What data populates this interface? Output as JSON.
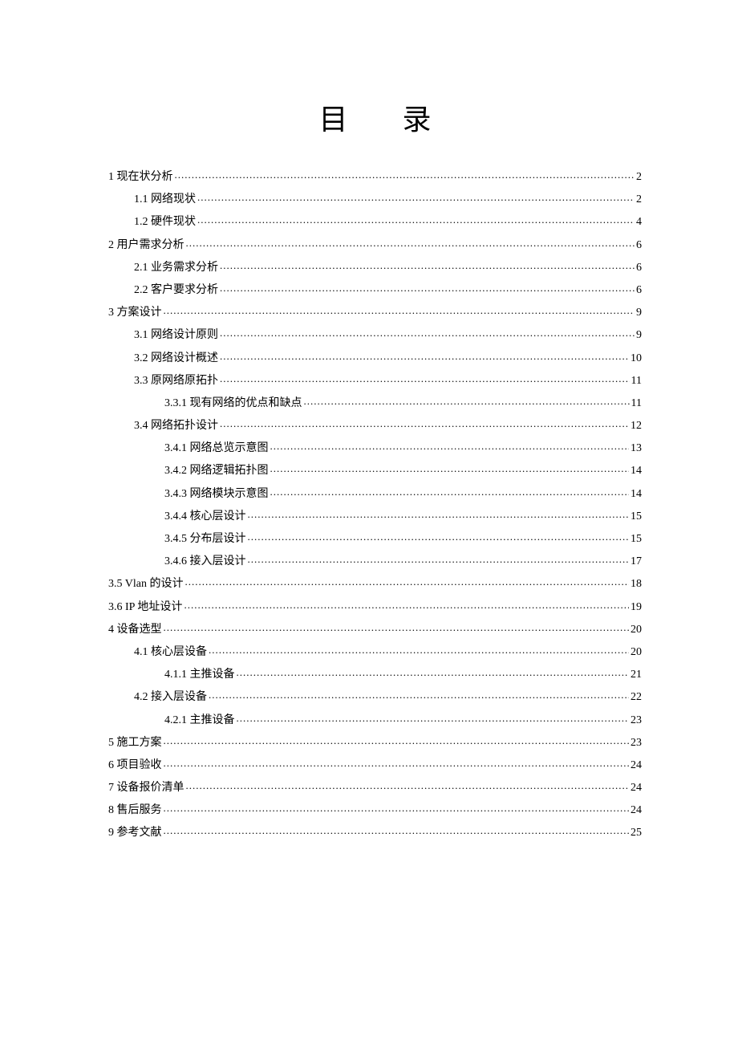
{
  "title_char1": "目",
  "title_char2": "录",
  "toc": [
    {
      "level": 0,
      "label": "1 现在状分析",
      "page": "2"
    },
    {
      "level": 1,
      "label": "1.1 网络现状",
      "page": "2"
    },
    {
      "level": 1,
      "label": "1.2 硬件现状",
      "page": "4"
    },
    {
      "level": 0,
      "label": "2 用户需求分析",
      "page": "6"
    },
    {
      "level": 1,
      "label": "2.1 业务需求分析",
      "page": "6"
    },
    {
      "level": 1,
      "label": "2.2 客户要求分析",
      "page": "6"
    },
    {
      "level": 0,
      "label": "3 方案设计",
      "page": "9"
    },
    {
      "level": 1,
      "label": "3.1 网络设计原则",
      "page": "9"
    },
    {
      "level": 1,
      "label": "3.2 网络设计概述",
      "page": "10"
    },
    {
      "level": 1,
      "label": "3.3 原网络原拓扑",
      "page": "11"
    },
    {
      "level": 2,
      "label": "3.3.1 现有网络的优点和缺点",
      "page": "11"
    },
    {
      "level": 1,
      "label": "3.4 网络拓扑设计",
      "page": "12"
    },
    {
      "level": 2,
      "label": "3.4.1 网络总览示意图",
      "page": "13"
    },
    {
      "level": 2,
      "label": "3.4.2 网络逻辑拓扑图",
      "page": "14"
    },
    {
      "level": 2,
      "label": "3.4.3 网络模块示意图",
      "page": "14"
    },
    {
      "level": 2,
      "label": "3.4.4 核心层设计",
      "page": "15"
    },
    {
      "level": 2,
      "label": "3.4.5 分布层设计",
      "page": "15"
    },
    {
      "level": 2,
      "label": "3.4.6 接入层设计",
      "page": "17"
    },
    {
      "level": 0,
      "label": "3.5 Vlan 的设计",
      "page": "18"
    },
    {
      "level": 0,
      "label": "3.6 IP 地址设计",
      "page": "19"
    },
    {
      "level": 0,
      "label": "4 设备选型",
      "page": "20"
    },
    {
      "level": 1,
      "label": "4.1 核心层设备",
      "page": "20"
    },
    {
      "level": 2,
      "label": "4.1.1 主推设备",
      "page": "21"
    },
    {
      "level": 1,
      "label": "4.2 接入层设备",
      "page": "22"
    },
    {
      "level": 2,
      "label": "4.2.1 主推设备",
      "page": "23"
    },
    {
      "level": 0,
      "label": "5 施工方案",
      "page": "23"
    },
    {
      "level": 0,
      "label": "6 项目验收",
      "page": "24"
    },
    {
      "level": 0,
      "label": "7 设备报价清单",
      "page": "24"
    },
    {
      "level": 0,
      "label": "8 售后服务",
      "page": "24"
    },
    {
      "level": 0,
      "label": "9 参考文献",
      "page": "25"
    }
  ]
}
